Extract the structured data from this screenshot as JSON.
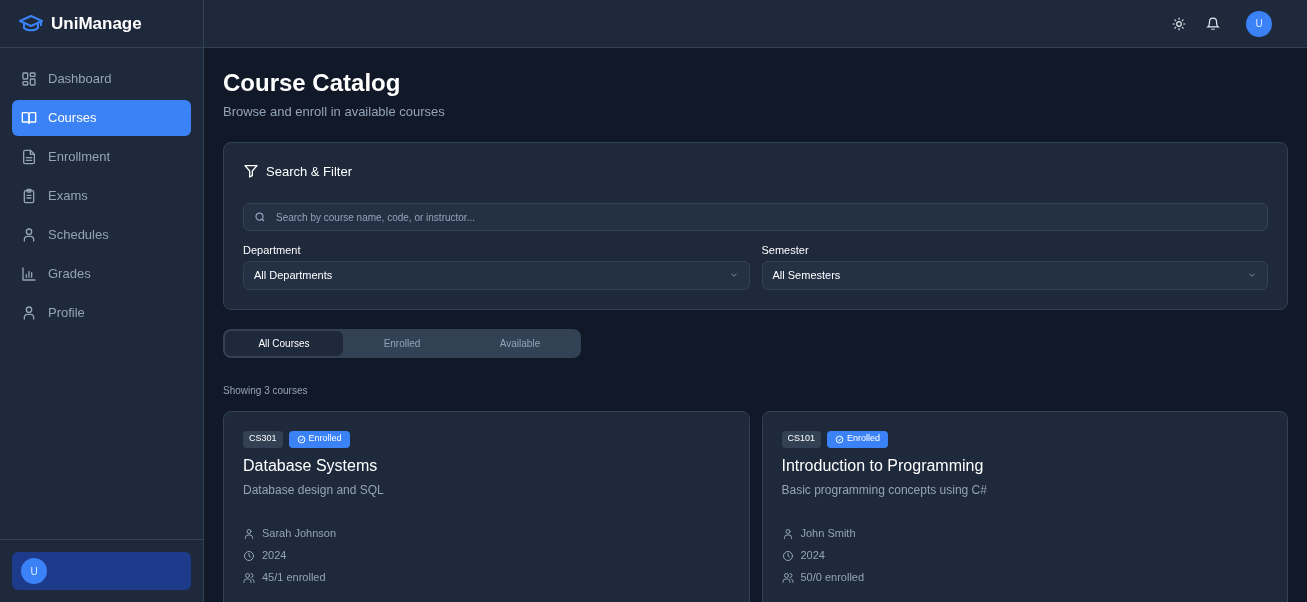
{
  "app": {
    "name": "UniManage"
  },
  "sidebar": {
    "items": [
      {
        "label": "Dashboard",
        "selected": false
      },
      {
        "label": "Courses",
        "selected": true
      },
      {
        "label": "Enrollment",
        "selected": false
      },
      {
        "label": "Exams",
        "selected": false
      },
      {
        "label": "Schedules",
        "selected": false
      },
      {
        "label": "Grades",
        "selected": false
      },
      {
        "label": "Profile",
        "selected": false
      }
    ],
    "user": {
      "initial": "U"
    }
  },
  "header": {
    "avatar": "U"
  },
  "page": {
    "title": "Course Catalog",
    "subtitle": "Browse and enroll in available courses"
  },
  "filter": {
    "title": "Search & Filter",
    "search_placeholder": "Search by course name, code, or instructor...",
    "selects": [
      {
        "label": "Department",
        "value": "All Departments"
      },
      {
        "label": "Semester",
        "value": "All Semesters"
      }
    ]
  },
  "tabs": [
    {
      "label": "All Courses",
      "selected": true
    },
    {
      "label": "Enrolled",
      "selected": false
    },
    {
      "label": "Available",
      "selected": false
    }
  ],
  "count": "Showing 3 courses",
  "courses": [
    {
      "code": "CS301",
      "status": "Enrolled",
      "title": "Database Systems",
      "description": "Database design and SQL",
      "instructor": "Sarah Johnson",
      "year": "2024",
      "enrolled": "45/1 enrolled"
    },
    {
      "code": "CS101",
      "status": "Enrolled",
      "title": "Introduction to Programming",
      "description": "Basic programming concepts using C#",
      "instructor": "John Smith",
      "year": "2024",
      "enrolled": "50/0 enrolled"
    }
  ]
}
